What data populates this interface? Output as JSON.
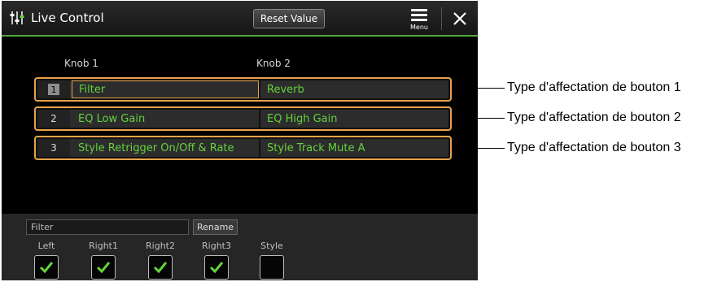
{
  "title_bar": {
    "title": "Live Control",
    "reset_label": "Reset Value",
    "menu_label": "Menu"
  },
  "columns": {
    "knob1": "Knob 1",
    "knob2": "Knob 2"
  },
  "rows": [
    {
      "number": "1",
      "knob1": "Filter",
      "knob2": "Reverb"
    },
    {
      "number": "2",
      "knob1": "EQ Low Gain",
      "knob2": "EQ High Gain"
    },
    {
      "number": "3",
      "knob1": "Style Retrigger On/Off & Rate",
      "knob2": "Style Track Mute A"
    }
  ],
  "bottom": {
    "filter_text": "Filter",
    "rename_label": "Rename",
    "parts": [
      {
        "label": "Left",
        "checked": true
      },
      {
        "label": "Right1",
        "checked": true
      },
      {
        "label": "Right2",
        "checked": true
      },
      {
        "label": "Right3",
        "checked": true
      },
      {
        "label": "Style",
        "checked": false
      }
    ]
  },
  "callouts": [
    "Type d'affectation de bouton 1",
    "Type d'affectation de bouton 2",
    "Type d'affectation de bouton 3"
  ],
  "colors": {
    "accent_green": "#64d23c",
    "highlight_orange": "#e8a24a",
    "title_underline": "#4fa83a"
  },
  "icons": [
    "sliders-icon",
    "menu-icon",
    "close-icon",
    "checkmark-icon"
  ]
}
